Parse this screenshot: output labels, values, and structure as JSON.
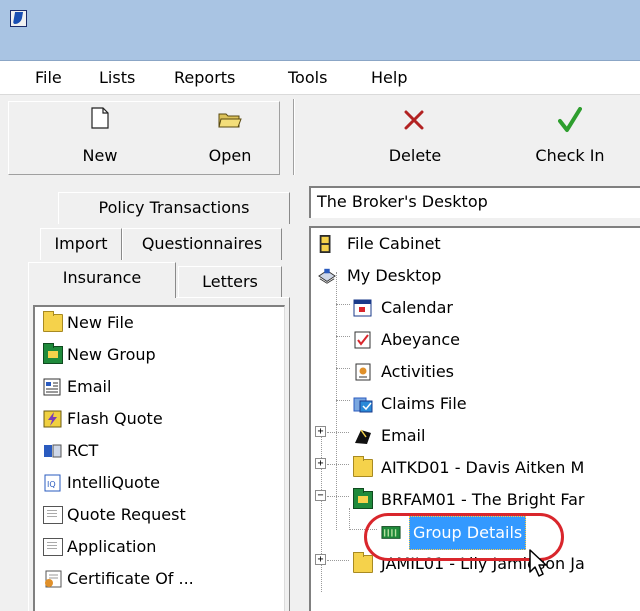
{
  "menu": {
    "items": [
      "File",
      "Lists",
      "Reports",
      "Tools",
      "Help"
    ]
  },
  "toolbar": {
    "new_label": "New",
    "open_label": "Open",
    "delete_label": "Delete",
    "checkin_label": "Check In"
  },
  "left_tabs": {
    "policy_transactions": "Policy Transactions",
    "import": "Import",
    "questionnaires": "Questionnaires",
    "insurance": "Insurance",
    "letters": "Letters"
  },
  "left_list": [
    {
      "label": "New File",
      "icon": "folder-icon"
    },
    {
      "label": "New Group",
      "icon": "group-folder-icon"
    },
    {
      "label": "Email",
      "icon": "email-form-icon"
    },
    {
      "label": "Flash Quote",
      "icon": "flash-quote-icon"
    },
    {
      "label": "RCT",
      "icon": "rct-icon"
    },
    {
      "label": "IntelliQuote",
      "icon": "intelliquote-icon"
    },
    {
      "label": "Quote Request",
      "icon": "document-icon"
    },
    {
      "label": "Application",
      "icon": "document-icon"
    },
    {
      "label": "Certificate Of ...",
      "icon": "certificate-icon"
    }
  ],
  "address_bar": {
    "value": "The Broker's Desktop"
  },
  "tree": {
    "file_cabinet": "File Cabinet",
    "my_desktop": "My Desktop",
    "calendar": "Calendar",
    "abeyance": "Abeyance",
    "activities": "Activities",
    "claims_file": "Claims File",
    "email": "Email",
    "aitkd01": "AITKD01 - Davis Aitken M",
    "brfam01": "BRFAM01 - The Bright Far",
    "group_details": "Group Details",
    "jamil01": "JAMIL01 - Lily Jamieson Ja"
  },
  "colors": {
    "titlebar": "#a9c4e3",
    "selection": "#3399ff",
    "highlight_ring": "#d9262c",
    "delete_icon": "#b22222",
    "checkin_icon": "#2e9e2e"
  }
}
